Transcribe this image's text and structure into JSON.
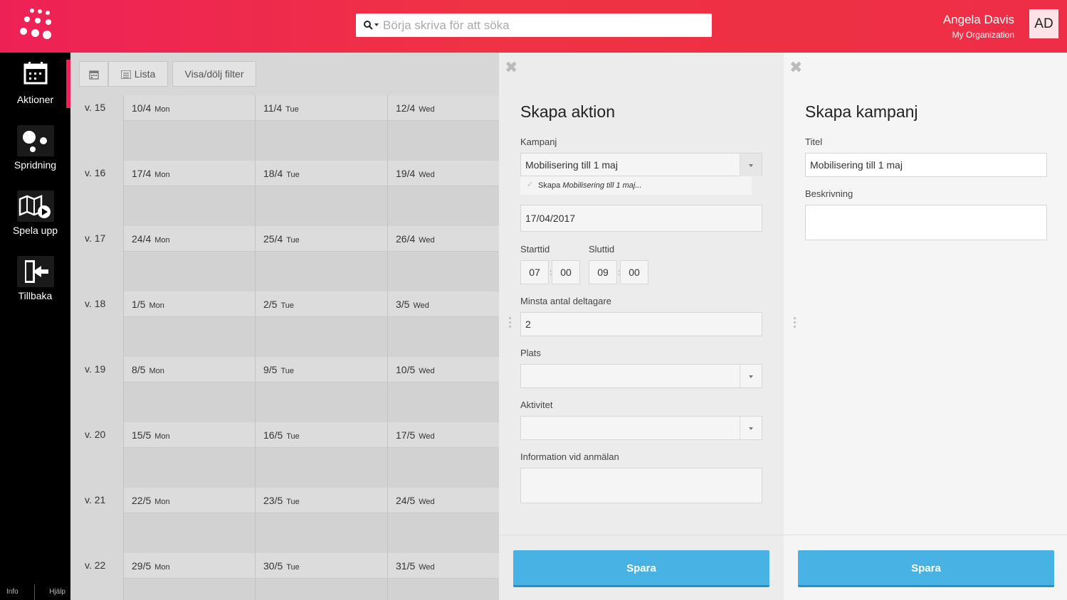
{
  "header": {
    "search_placeholder": "Börja skriva för att söka",
    "user_name": "Angela Davis",
    "user_org": "My Organization",
    "avatar_initials": "AD"
  },
  "sidebar": {
    "items": [
      {
        "label": "Aktioner",
        "icon": "calendar-icon"
      },
      {
        "label": "Spridning",
        "icon": "dots-icon"
      },
      {
        "label": "Spela upp",
        "icon": "map-play-icon"
      },
      {
        "label": "Tillbaka",
        "icon": "exit-icon"
      }
    ],
    "footer_info": "Info",
    "footer_help": "Hjälp"
  },
  "calendar": {
    "toolbar": {
      "list_label": "Lista",
      "filter_label": "Visa/dölj filter"
    },
    "weeks": [
      {
        "week": "v. 15",
        "days": [
          {
            "date": "10/4",
            "day": "Mon"
          },
          {
            "date": "11/4",
            "day": "Tue"
          },
          {
            "date": "12/4",
            "day": "Wed"
          }
        ]
      },
      {
        "week": "v. 16",
        "days": [
          {
            "date": "17/4",
            "day": "Mon"
          },
          {
            "date": "18/4",
            "day": "Tue"
          },
          {
            "date": "19/4",
            "day": "Wed"
          }
        ]
      },
      {
        "week": "v. 17",
        "days": [
          {
            "date": "24/4",
            "day": "Mon"
          },
          {
            "date": "25/4",
            "day": "Tue"
          },
          {
            "date": "26/4",
            "day": "Wed"
          }
        ]
      },
      {
        "week": "v. 18",
        "days": [
          {
            "date": "1/5",
            "day": "Mon"
          },
          {
            "date": "2/5",
            "day": "Tue"
          },
          {
            "date": "3/5",
            "day": "Wed"
          }
        ]
      },
      {
        "week": "v. 19",
        "days": [
          {
            "date": "8/5",
            "day": "Mon"
          },
          {
            "date": "9/5",
            "day": "Tue"
          },
          {
            "date": "10/5",
            "day": "Wed"
          }
        ]
      },
      {
        "week": "v. 20",
        "days": [
          {
            "date": "15/5",
            "day": "Mon"
          },
          {
            "date": "16/5",
            "day": "Tue"
          },
          {
            "date": "17/5",
            "day": "Wed"
          }
        ]
      },
      {
        "week": "v. 21",
        "days": [
          {
            "date": "22/5",
            "day": "Mon"
          },
          {
            "date": "23/5",
            "day": "Tue"
          },
          {
            "date": "24/5",
            "day": "Wed"
          }
        ]
      },
      {
        "week": "v. 22",
        "days": [
          {
            "date": "29/5",
            "day": "Mon"
          },
          {
            "date": "30/5",
            "day": "Tue"
          },
          {
            "date": "31/5",
            "day": "Wed"
          }
        ]
      }
    ]
  },
  "action_panel": {
    "title": "Skapa aktion",
    "campaign_label": "Kampanj",
    "campaign_value": "Mobilisering till 1 maj",
    "suggestion_prefix": "Skapa",
    "suggestion_name": "Mobilisering till 1 maj...",
    "date_value": "17/04/2017",
    "start_label": "Starttid",
    "end_label": "Sluttid",
    "start_hour": "07",
    "start_min": "00",
    "end_hour": "09",
    "end_min": "00",
    "min_participants_label": "Minsta antal deltagare",
    "min_participants_value": "2",
    "place_label": "Plats",
    "activity_label": "Aktivitet",
    "info_label": "Information vid anmälan",
    "save_label": "Spara"
  },
  "campaign_panel": {
    "title": "Skapa kampanj",
    "title_label": "Titel",
    "title_value": "Mobilisering till 1 maj",
    "description_label": "Beskrivning",
    "save_label": "Spara"
  },
  "colors": {
    "brand": "#ee2156",
    "save": "#48b2e4"
  }
}
